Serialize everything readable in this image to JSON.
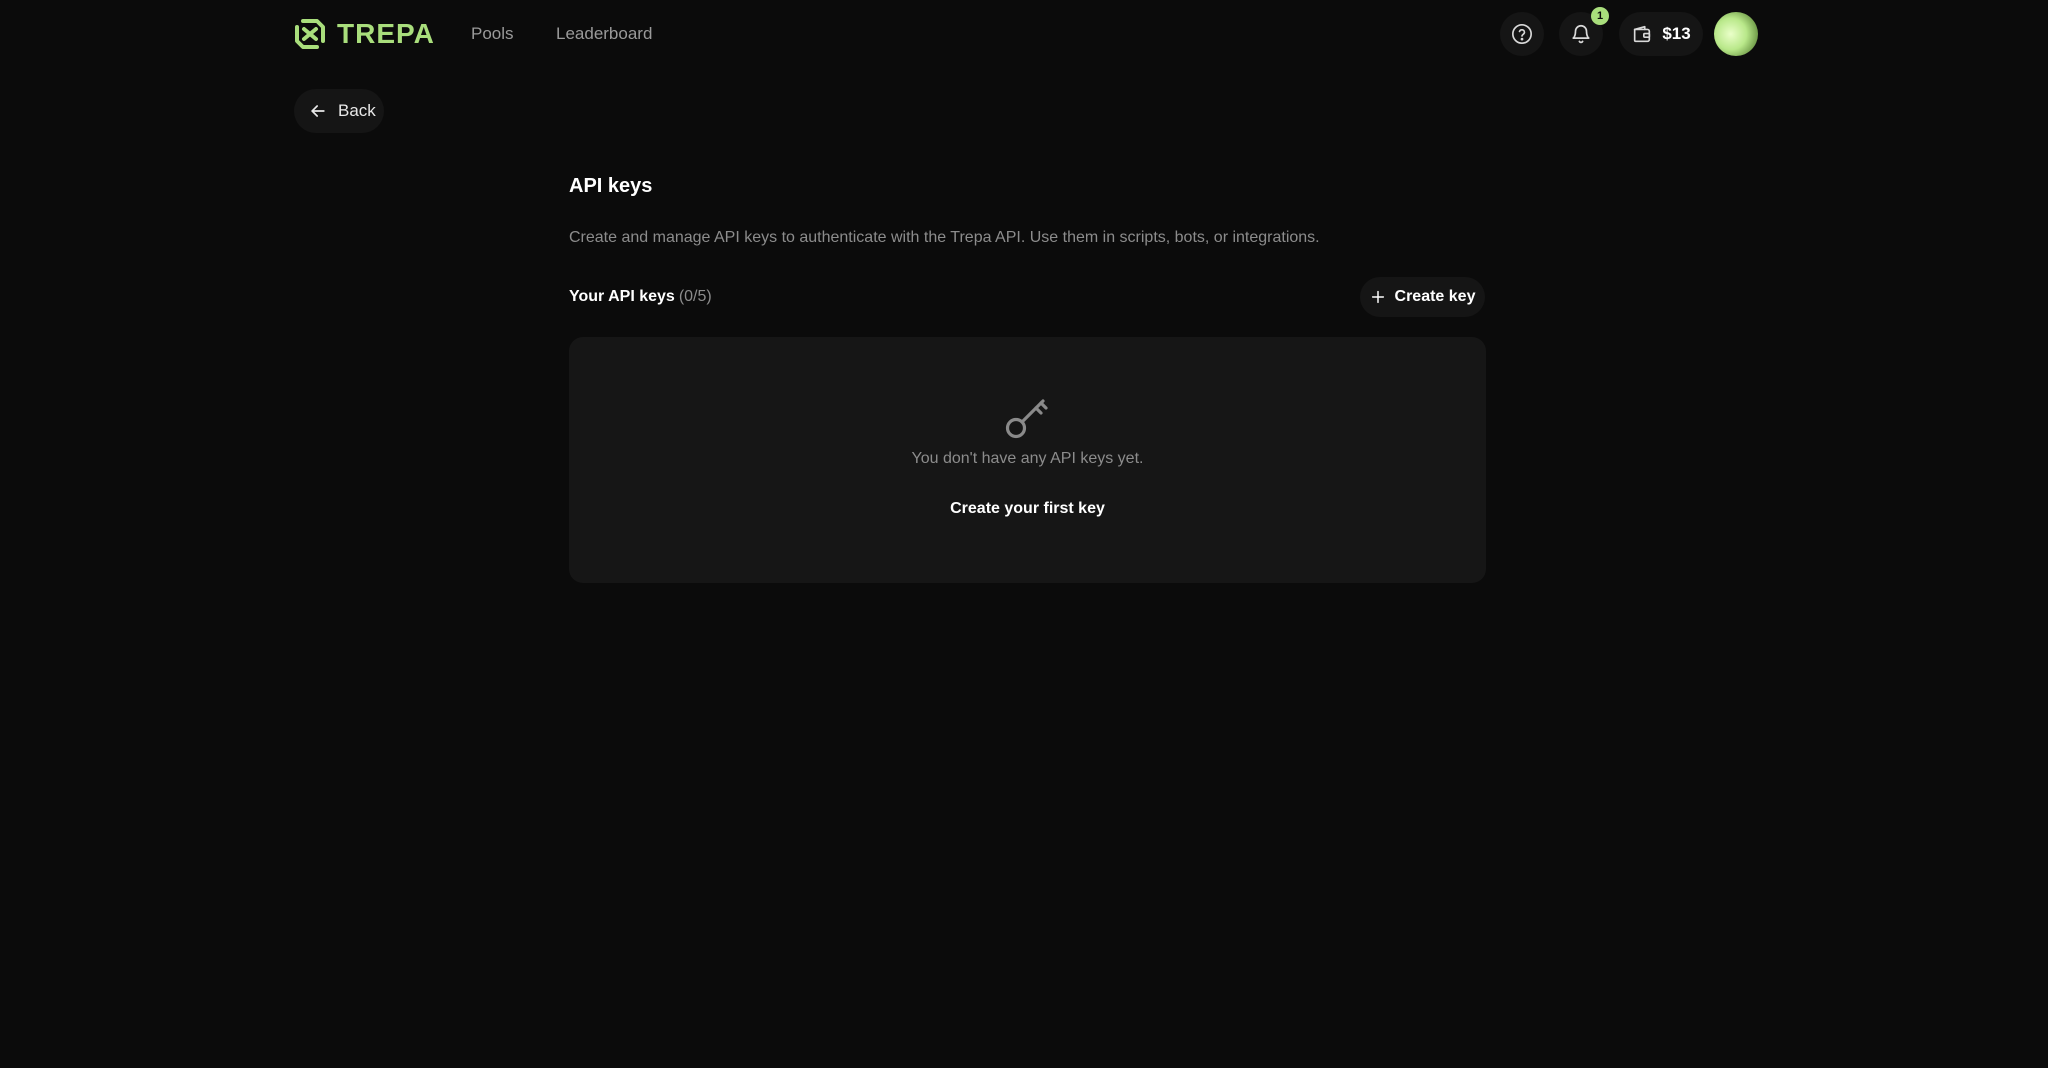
{
  "header": {
    "brand": "TREPA",
    "nav": [
      {
        "label": "Pools"
      },
      {
        "label": "Leaderboard"
      }
    ],
    "help_icon": "question-circle-icon",
    "notifications": {
      "icon": "bell-icon",
      "badge_count": "1"
    },
    "wallet": {
      "icon": "wallet-icon",
      "amount": "$13"
    },
    "avatar": "user-avatar"
  },
  "back": {
    "label": "Back",
    "icon": "arrow-left-icon"
  },
  "page": {
    "title": "API keys",
    "description": "Create and manage API keys to authenticate with the Trepa API. Use them in scripts, bots, or integrations."
  },
  "keys": {
    "heading": "Your API keys",
    "count": "(0/5)",
    "create_button": {
      "label": "Create key",
      "icon": "plus-icon"
    },
    "empty_state": {
      "icon": "key-icon",
      "message": "You don't have any API keys yet.",
      "action": "Create your first key"
    }
  },
  "colors": {
    "background": "#0b0b0b",
    "surface": "#151515",
    "card": "#161616",
    "accent": "#a9de7c",
    "muted_text": "#8c8c8c"
  }
}
